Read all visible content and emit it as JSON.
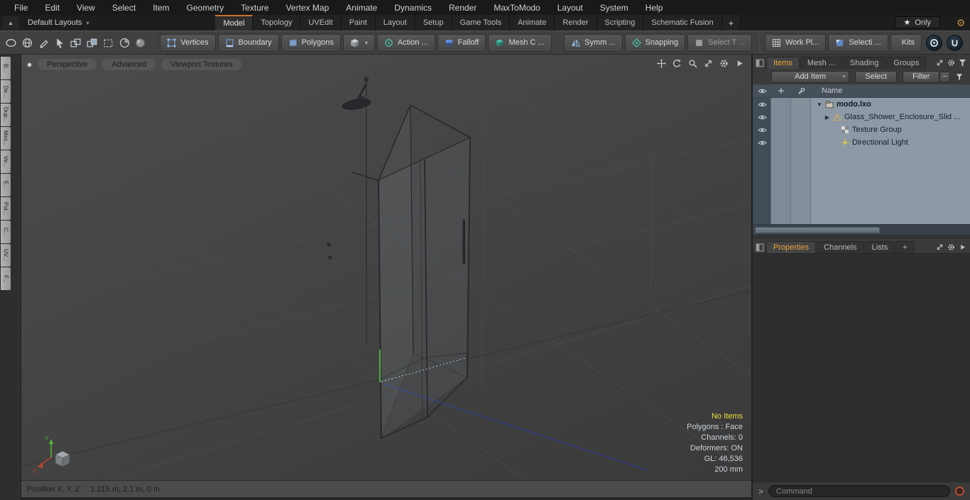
{
  "glyphs": {
    "caret_down": "▾",
    "tri_down": "▼",
    "tri_right": "▶",
    "star": "★",
    "up": "▲",
    "minus": "−"
  },
  "menu_bar": {
    "items": [
      "File",
      "Edit",
      "View",
      "Select",
      "Item",
      "Geometry",
      "Texture",
      "Vertex Map",
      "Animate",
      "Dynamics",
      "Render",
      "MaxToModo",
      "Layout",
      "System",
      "Help"
    ]
  },
  "layout_bar": {
    "preset_label": "Default Layouts",
    "tabs": [
      "Model",
      "Topology",
      "UVEdit",
      "Paint",
      "Layout",
      "Setup",
      "Game Tools",
      "Animate",
      "Render",
      "Scripting",
      "Schematic Fusion"
    ],
    "add_tab": "+",
    "only_label": "Only"
  },
  "toolbar": {
    "vertices": "Vertices",
    "boundary": "Boundary",
    "polygons": "Polygons",
    "action": "Action  ...",
    "falloff": "Falloff",
    "mesh_c": "Mesh C ...",
    "symm": "Symm ...",
    "snapping": "Snapping",
    "select_t": "Select T ...",
    "work_pl": "Work Pl...",
    "selecti": "Selecti ...",
    "kits": "Kits"
  },
  "left_tool_tabs": [
    "B...",
    "De...",
    "Dup...",
    "Mes...",
    "Ve...",
    "E...",
    "Pol...",
    "C...",
    "UV...",
    "F..."
  ],
  "viewport": {
    "mode_button": "Perspective",
    "shading_button": "Advanced",
    "textures_button": "Viewport Textures",
    "axis_y": "Y",
    "axis_x": "X",
    "status": {
      "no_items": "No Items",
      "polygons": "Polygons : Face",
      "channels": "Channels: 0",
      "deformers": "Deformers: ON",
      "gl": "GL: 46,536",
      "grid_size": "200 mm"
    },
    "position_label": "Position X, Y, Z:",
    "position_value": "1.215 m, 2.1 m, 0 m"
  },
  "items_panel": {
    "tabs": [
      "Items",
      "Mesh ...",
      "Shading",
      "Groups"
    ],
    "add_item_label": "Add Item",
    "select_label": "Select",
    "filter_label": "Filter",
    "name_header": "Name",
    "rows": [
      {
        "label": "modo.lxo"
      },
      {
        "label": "Glass_Shower_Enclosure_Slid ..."
      },
      {
        "label": "Texture Group"
      },
      {
        "label": "Directional Light"
      }
    ]
  },
  "properties_panel": {
    "tabs": [
      "Properties",
      "Channels",
      "Lists"
    ],
    "add_tab": "+"
  },
  "command_bar": {
    "prompt": ">",
    "placeholder": "Command"
  }
}
